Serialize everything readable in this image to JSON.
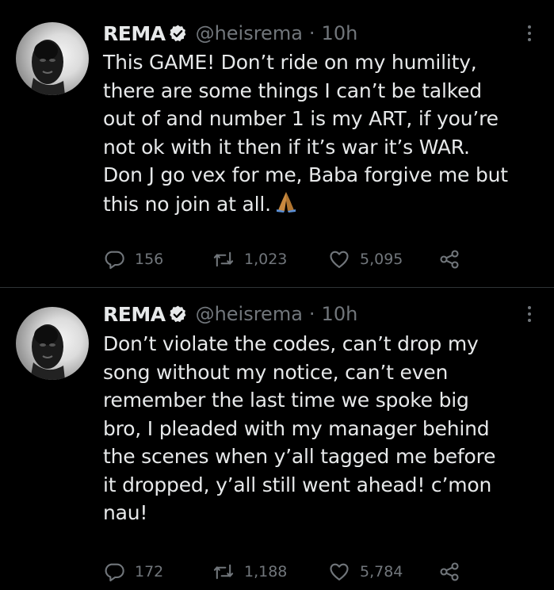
{
  "tweets": [
    {
      "name": "REMA",
      "handle": "@heisrema",
      "separator": "·",
      "time": "10h",
      "text": "This GAME! Don’t ride on my humility,\nthere are some things I can’t be talked\nout of and number 1 is my ART, if you’re\nnot ok with it then if it’s war it’s WAR.\nDon J go vex for me, Baba forgive me but\nthis no join at all.",
      "emoji": "folded-hands",
      "replies": "156",
      "retweets": "1,023",
      "likes": "5,095"
    },
    {
      "name": "REMA",
      "handle": "@heisrema",
      "separator": "·",
      "time": "10h",
      "text": "Don’t violate the codes, can’t drop my\nsong without my notice, can’t even\nremember the last time we spoke big\nbro, I pleaded with my manager behind\nthe scenes when y’all tagged me before\nit dropped, y’all still went ahead! c’mon\nnau!",
      "replies": "172",
      "retweets": "1,188",
      "likes": "5,784"
    }
  ],
  "icons": {
    "verified": "verified-badge-icon",
    "more": "more-vertical-icon",
    "reply": "reply-icon",
    "retweet": "retweet-icon",
    "like": "heart-icon",
    "share": "share-icon"
  },
  "colors": {
    "background": "#000000",
    "text": "#e7e9ea",
    "secondary": "#71767b",
    "divider": "#2f3336"
  }
}
